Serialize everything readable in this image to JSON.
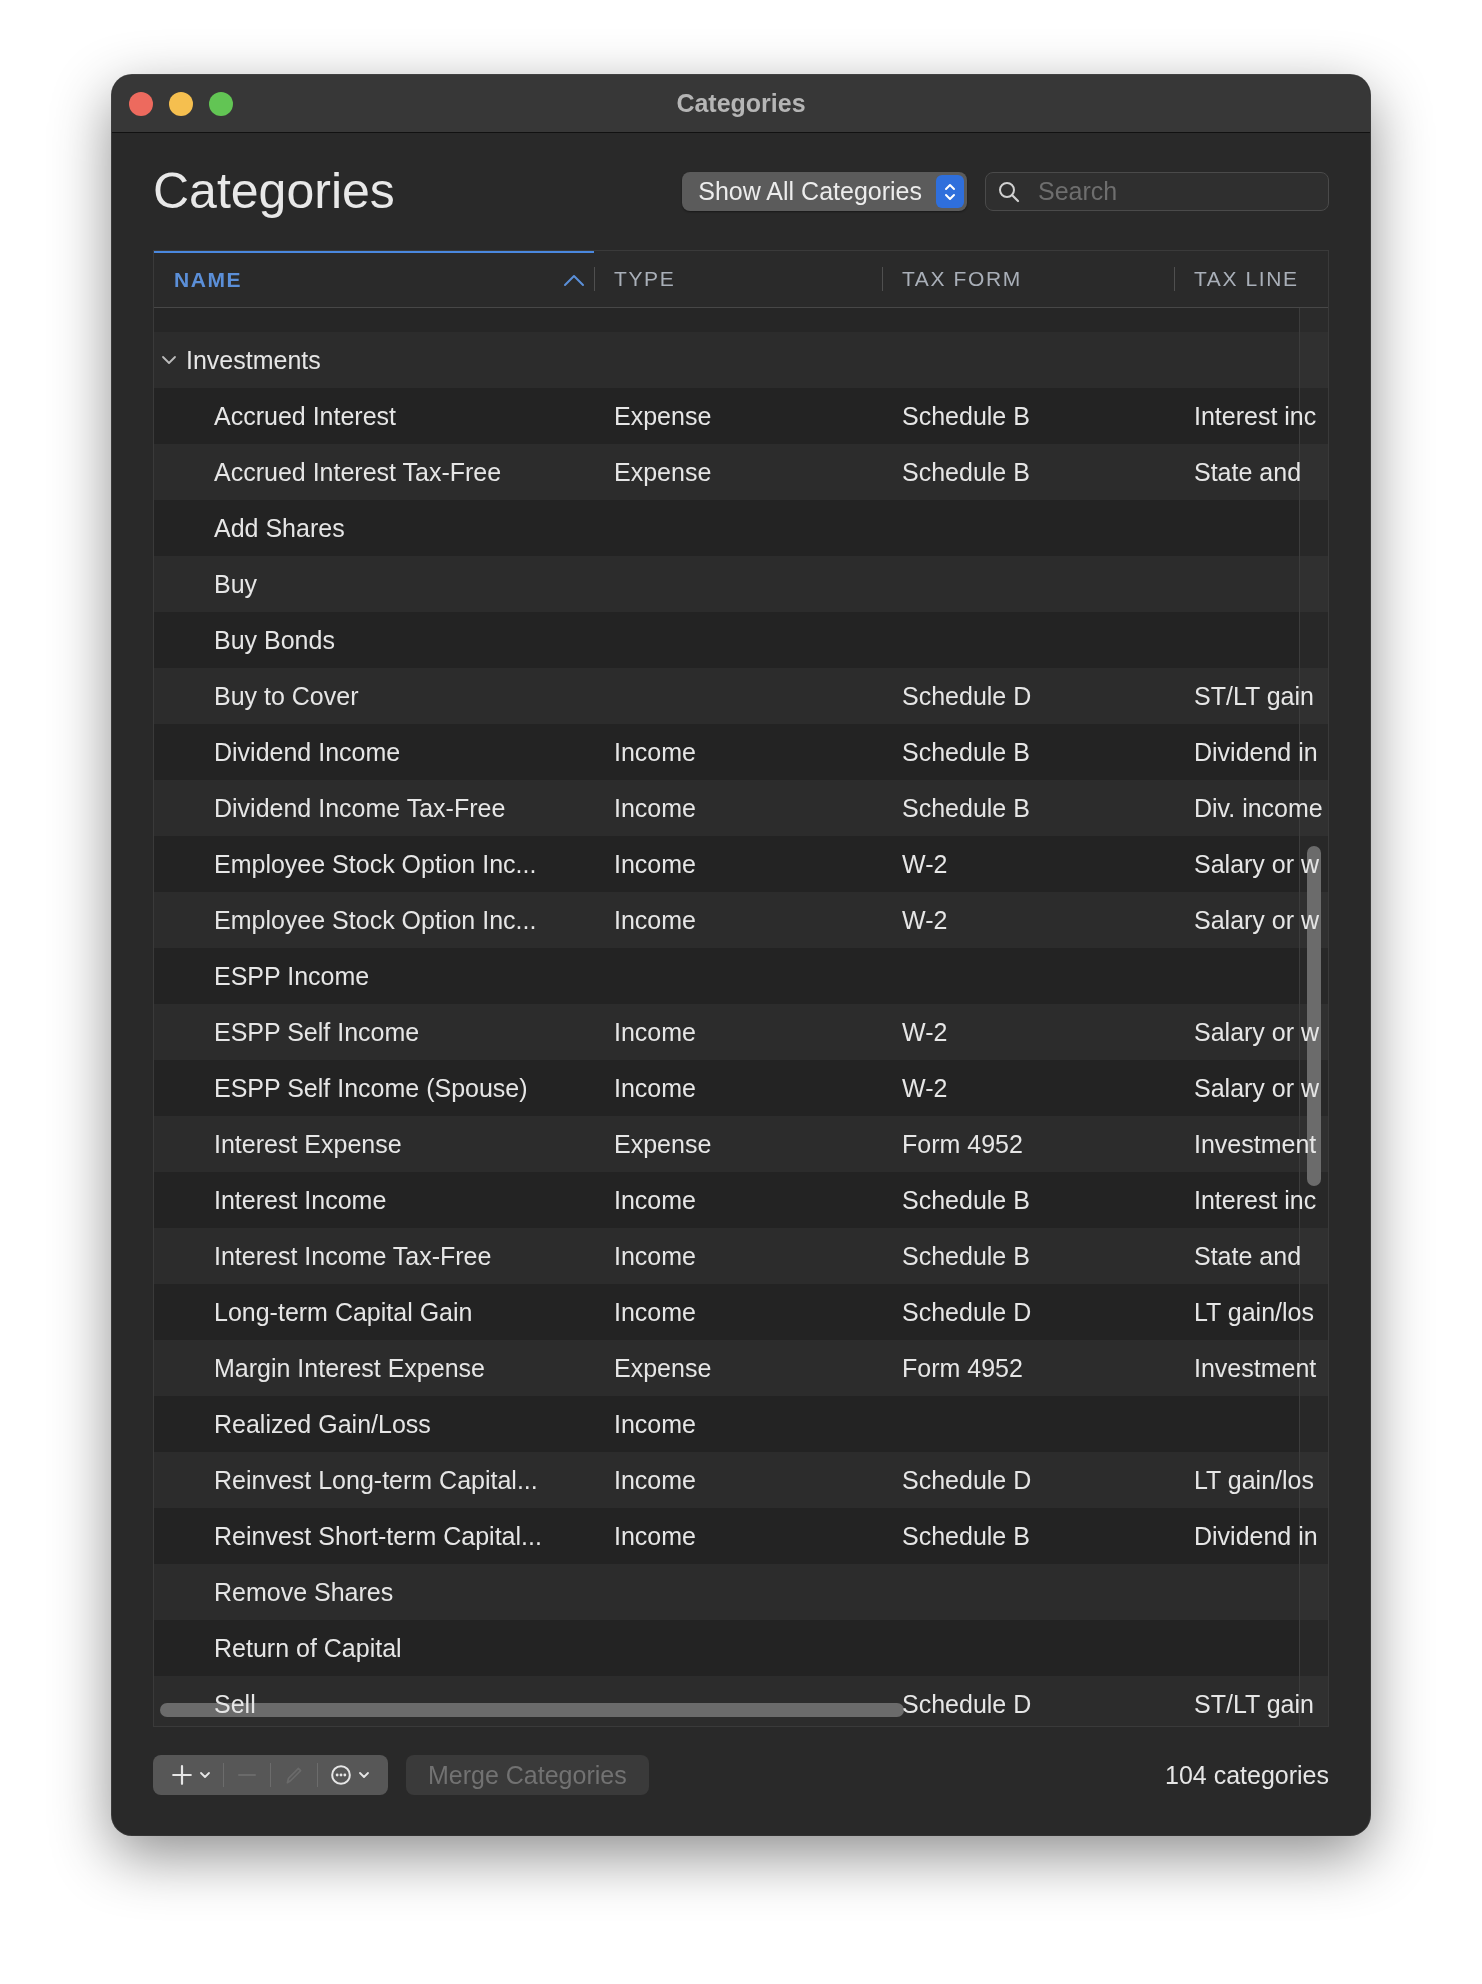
{
  "window": {
    "title": "Categories"
  },
  "heading": "Categories",
  "filter": {
    "label": "Show All Categories"
  },
  "search": {
    "placeholder": "Search"
  },
  "table": {
    "columns": [
      {
        "label": "NAME",
        "sorted": true
      },
      {
        "label": "TYPE",
        "sorted": false
      },
      {
        "label": "TAX FORM",
        "sorted": false
      },
      {
        "label": "TAX LINE",
        "sorted": false
      }
    ],
    "groups": [
      {
        "name": "Investments",
        "expanded": true,
        "children": [
          {
            "name": "Accrued Interest",
            "type": "Expense",
            "tax_form": "Schedule B",
            "tax_line": "Interest inc"
          },
          {
            "name": "Accrued Interest Tax-Free",
            "type": "Expense",
            "tax_form": "Schedule B",
            "tax_line": "State and"
          },
          {
            "name": "Add Shares"
          },
          {
            "name": "Buy"
          },
          {
            "name": "Buy Bonds"
          },
          {
            "name": "Buy to Cover",
            "tax_form": "Schedule D",
            "tax_line": "ST/LT gain"
          },
          {
            "name": "Dividend Income",
            "type": "Income",
            "tax_form": "Schedule B",
            "tax_line": "Dividend in"
          },
          {
            "name": "Dividend Income Tax-Free",
            "type": "Income",
            "tax_form": "Schedule B",
            "tax_line": "Div. income"
          },
          {
            "name": "Employee Stock Option Inc...",
            "type": "Income",
            "tax_form": "W-2",
            "tax_line": "Salary or w"
          },
          {
            "name": "Employee Stock Option Inc...",
            "type": "Income",
            "tax_form": "W-2",
            "tax_line": "Salary or w"
          },
          {
            "name": "ESPP Income"
          },
          {
            "name": "ESPP Self Income",
            "type": "Income",
            "tax_form": "W-2",
            "tax_line": "Salary or w"
          },
          {
            "name": "ESPP Self Income (Spouse)",
            "type": "Income",
            "tax_form": "W-2",
            "tax_line": "Salary or w"
          },
          {
            "name": "Interest Expense",
            "type": "Expense",
            "tax_form": "Form 4952",
            "tax_line": "Investment"
          },
          {
            "name": "Interest Income",
            "type": "Income",
            "tax_form": "Schedule B",
            "tax_line": "Interest inc"
          },
          {
            "name": "Interest Income Tax-Free",
            "type": "Income",
            "tax_form": "Schedule B",
            "tax_line": "State and"
          },
          {
            "name": "Long-term Capital Gain",
            "type": "Income",
            "tax_form": "Schedule D",
            "tax_line": "LT gain/los"
          },
          {
            "name": "Margin Interest Expense",
            "type": "Expense",
            "tax_form": "Form 4952",
            "tax_line": "Investment"
          },
          {
            "name": "Realized Gain/Loss",
            "type": "Income"
          },
          {
            "name": "Reinvest Long-term Capital...",
            "type": "Income",
            "tax_form": "Schedule D",
            "tax_line": "LT gain/los"
          },
          {
            "name": "Reinvest Short-term Capital...",
            "type": "Income",
            "tax_form": "Schedule B",
            "tax_line": "Dividend in"
          },
          {
            "name": "Remove Shares"
          },
          {
            "name": "Return of Capital"
          },
          {
            "name": "Sell",
            "tax_form": "Schedule D",
            "tax_line": "ST/LT gain"
          }
        ]
      }
    ]
  },
  "toolbar": {
    "buttons": [
      {
        "kind": "add",
        "disabled": false
      },
      {
        "kind": "remove",
        "disabled": true
      },
      {
        "kind": "edit",
        "disabled": true
      },
      {
        "kind": "more",
        "disabled": false
      }
    ],
    "merge": {
      "label": "Merge Categories",
      "disabled": true
    }
  },
  "status": "104 categories"
}
